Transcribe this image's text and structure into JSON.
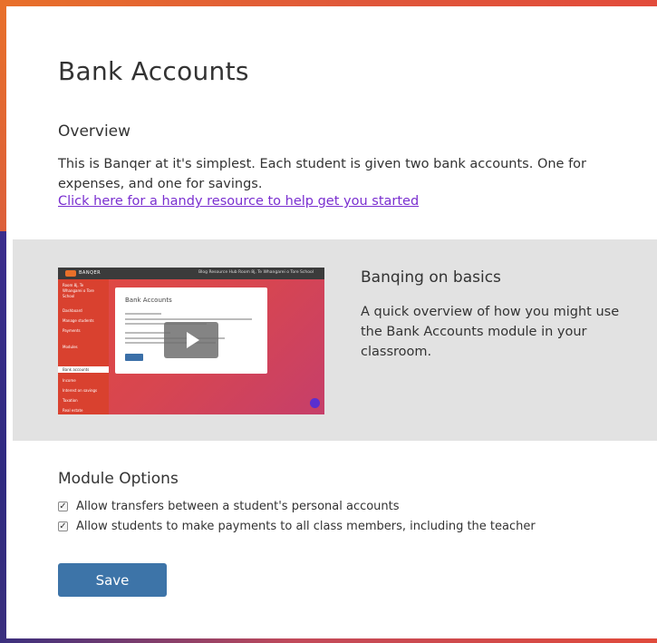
{
  "page": {
    "title": "Bank Accounts"
  },
  "overview": {
    "heading": "Overview",
    "text": "This is Banqer at it's simplest. Each student is given two bank accounts. One for expenses, and one for savings.",
    "link_text": "Click here for a handy resource to help get you started"
  },
  "video": {
    "heading": "Banqing on basics",
    "description": "A quick overview of how you might use the Bank Accounts module in your classroom.",
    "thumbnail": {
      "logo_text": "BANQER",
      "nav_text": "Blog   Resource Hub   Room 8j, Te Whangarei o Tore School",
      "card_title": "Bank Accounts",
      "sidebar_items": [
        "Room 8j, Te",
        "Whangarei o Tore",
        "School",
        "Dashboard",
        "Manage students",
        "Payments",
        "Modules",
        "Bank accounts",
        "Income",
        "Interest on savings",
        "Taxation",
        "Real estate"
      ]
    }
  },
  "module_options": {
    "heading": "Module Options",
    "options": [
      {
        "label": "Allow transfers between a student's personal accounts",
        "checked": true
      },
      {
        "label": "Allow students to make payments to all class members, including the teacher",
        "checked": true
      }
    ]
  },
  "actions": {
    "save_label": "Save"
  },
  "icons": {
    "play": "play-icon",
    "checkmark": "check-icon",
    "chat": "chat-icon"
  },
  "colors": {
    "link": "#7a2fd0",
    "save_button": "#3d74a8",
    "band": "#e2e2e2",
    "accent_orange": "#e8702a",
    "accent_purple": "#3b2d8c"
  }
}
